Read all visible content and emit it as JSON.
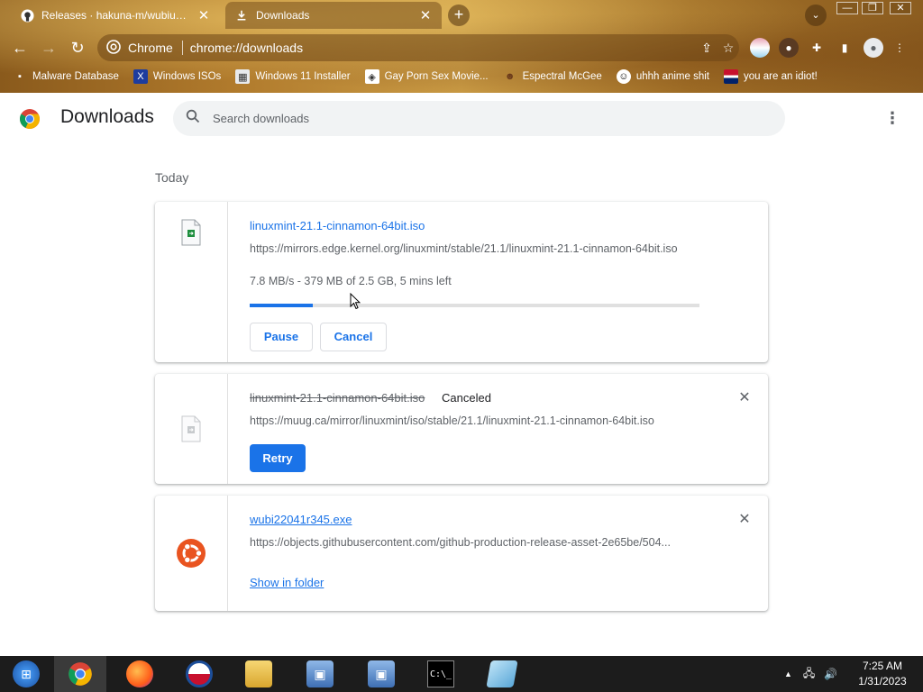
{
  "tabs": [
    {
      "title": "Releases · hakuna-m/wubiuefi · GitHub",
      "icon": "github-icon",
      "active": false
    },
    {
      "title": "Downloads",
      "icon": "download-icon",
      "active": true
    }
  ],
  "window_controls": {
    "minimize": "—",
    "maximize": "❐",
    "close": "✕"
  },
  "toolbar": {
    "site_chip": "Chrome",
    "url": "chrome://downloads"
  },
  "bookmarks": [
    {
      "label": "Malware Database",
      "icon": "folder-icon"
    },
    {
      "label": "Windows ISOs",
      "icon": "x-icon"
    },
    {
      "label": "Windows 11 Installer",
      "icon": "image-icon"
    },
    {
      "label": "Gay Porn Sex Movie...",
      "icon": "site-icon"
    },
    {
      "label": "Espectral McGee",
      "icon": "site-icon"
    },
    {
      "label": "uhhh anime shit",
      "icon": "site-icon"
    },
    {
      "label": "you are an idiot!",
      "icon": "flag-icon"
    }
  ],
  "page": {
    "title": "Downloads",
    "search_placeholder": "Search downloads",
    "section_date": "Today"
  },
  "downloads": [
    {
      "name": "linuxmint-21.1-cinnamon-64bit.iso",
      "url": "https://mirrors.edge.kernel.org/linuxmint/stable/21.1/linuxmint-21.1-cinnamon-64bit.iso",
      "progress_text": "7.8 MB/s - 379 MB of 2.5 GB, 5 mins left",
      "progress_fraction": 0.14,
      "buttons": {
        "pause": "Pause",
        "cancel": "Cancel"
      }
    },
    {
      "name": "linuxmint-21.1-cinnamon-64bit.iso",
      "status": "Canceled",
      "url": "https://muug.ca/mirror/linuxmint/iso/stable/21.1/linuxmint-21.1-cinnamon-64bit.iso",
      "buttons": {
        "retry": "Retry"
      }
    },
    {
      "name": "wubi22041r345.exe",
      "url": "https://objects.githubusercontent.com/github-production-release-asset-2e65be/504...",
      "buttons": {
        "show_in_folder": "Show in folder"
      }
    }
  ],
  "taskbar": {
    "time": "7:25 AM",
    "date": "1/31/2023"
  },
  "colors": {
    "accent": "#1a73e8",
    "chrome_theme": "#b07a2c",
    "taskbar": "#1c1c1c"
  }
}
